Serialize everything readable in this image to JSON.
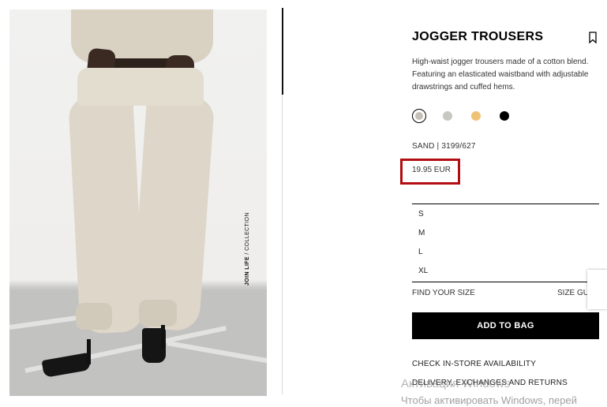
{
  "product": {
    "title": "JOGGER TROUSERS",
    "description": "High-waist jogger trousers made of a cotton blend. Featuring an elasticated waistband with adjustable drawstrings and cuffed hems.",
    "reference": "SAND | 3199/627",
    "price": "19.95 EUR"
  },
  "photo": {
    "caption_bold": "JOIN LIFE",
    "caption_rest": " / COLLECTION"
  },
  "colors": [
    {
      "name": "sand",
      "hex": "#c6c1b8",
      "selected": true
    },
    {
      "name": "light-grey",
      "hex": "#c5c9c2",
      "selected": false
    },
    {
      "name": "yellow",
      "hex": "#f0c275",
      "selected": false
    },
    {
      "name": "black",
      "hex": "#000000",
      "selected": false
    }
  ],
  "sizes": [
    "S",
    "M",
    "L",
    "XL"
  ],
  "size_help": {
    "find_your_size": "FIND YOUR SIZE",
    "size_guide": "SIZE GU"
  },
  "actions": {
    "add_to_bag": "ADD TO BAG",
    "check_store": "CHECK IN-STORE AVAILABILITY",
    "delivery": "DELIVERY, EXCHANGES AND RETURNS"
  },
  "watermark": {
    "line1": "Активация Windows",
    "line2": "Чтобы активировать Windows, перей"
  },
  "icons": {
    "bookmark": "bookmark-icon"
  },
  "highlight_color": "#b20d12"
}
